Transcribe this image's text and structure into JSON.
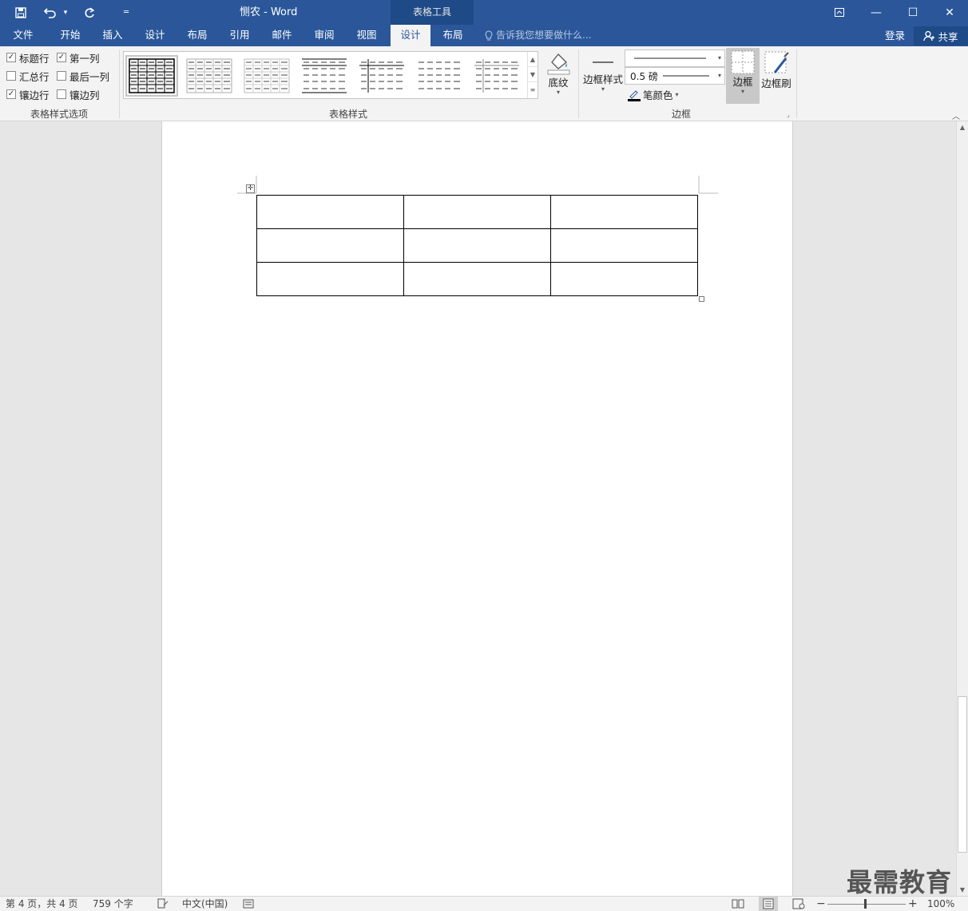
{
  "titlebar": {
    "doc_title": "恻农 - Word",
    "context_group": "表格工具",
    "qat": {
      "save_icon": "save-icon",
      "undo_icon": "undo-icon",
      "redo_icon": "redo-icon",
      "customize_icon": "customize-qat-icon"
    },
    "controls": {
      "ribbon_display": "▣",
      "minimize": "—",
      "maximize": "☐",
      "close": "✕"
    }
  },
  "tabs": [
    {
      "label": "文件"
    },
    {
      "label": "开始"
    },
    {
      "label": "插入"
    },
    {
      "label": "设计"
    },
    {
      "label": "布局"
    },
    {
      "label": "引用"
    },
    {
      "label": "邮件"
    },
    {
      "label": "审阅"
    },
    {
      "label": "视图"
    },
    {
      "label": "设计"
    },
    {
      "label": "布局"
    }
  ],
  "tellme": {
    "placeholder": "告诉我您想要做什么..."
  },
  "account": {
    "signin": "登录",
    "share": "共享"
  },
  "ribbon": {
    "style_options": {
      "items": [
        {
          "label": "标题行",
          "checked": true
        },
        {
          "label": "第一列",
          "checked": true
        },
        {
          "label": "汇总行",
          "checked": false
        },
        {
          "label": "最后一列",
          "checked": false
        },
        {
          "label": "镶边行",
          "checked": true
        },
        {
          "label": "镶边列",
          "checked": false
        }
      ],
      "group_label": "表格样式选项"
    },
    "table_styles": {
      "group_label": "表格样式",
      "shading_label": "底纹"
    },
    "borders": {
      "border_styles_label": "边框样式",
      "line_weight": "0.5 磅",
      "pen_color_label": "笔颜色",
      "borders_label": "边框",
      "border_painter_label": "边框刷",
      "group_label": "边框"
    }
  },
  "status": {
    "page": "第 4 页，共 4 页",
    "words": "759 个字",
    "language": "中文(中国)",
    "zoom": "100%"
  },
  "watermark": "最需教育"
}
